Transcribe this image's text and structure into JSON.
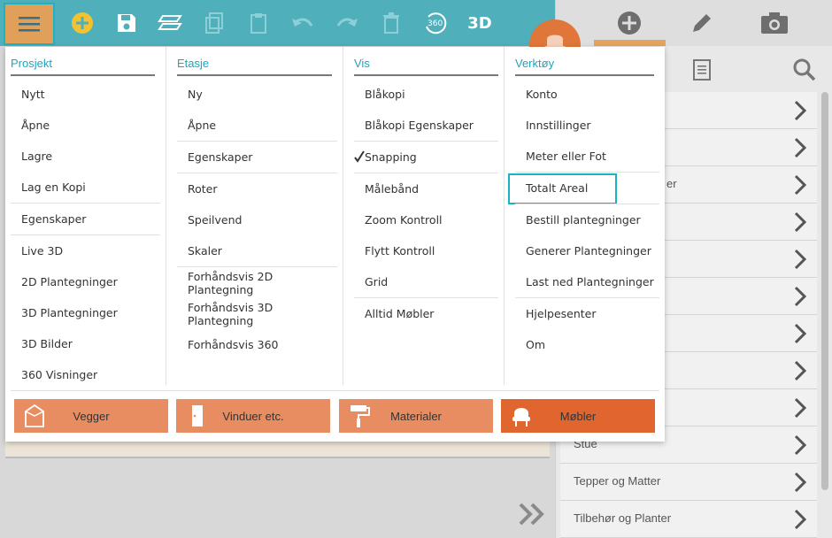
{
  "toolbar": {
    "buttons": [
      "menu-icon",
      "add-circle-icon",
      "save-icon",
      "layers-icon",
      "copy-icon",
      "clipboard-icon",
      "undo-icon",
      "redo-icon",
      "trash-icon",
      "view-360-icon",
      "view-3d-icon"
    ],
    "view_360_label": "360",
    "view_3d_label": "3D"
  },
  "colors": {
    "toolbar_bg": "#4fb0bb",
    "menu_button_bg": "#e0a05a",
    "highlight": "#1cb2c6",
    "column_header": "#1aa7bd",
    "category_button": "#e88d62",
    "category_button_active": "#e0652f"
  },
  "right_panel": {
    "tabs": [
      "add-circle-icon",
      "pencil-icon",
      "camera-icon"
    ],
    "sub_icons": [
      "document-icon",
      "search-icon"
    ],
    "partial_text": "er",
    "items": [
      "",
      "",
      "",
      "",
      "",
      "",
      "",
      "",
      "",
      "Stue",
      "Tepper og Matter",
      "Tilbehør og Planter"
    ]
  },
  "menu": {
    "columns": [
      {
        "header": "Prosjekt",
        "items": [
          "Nytt",
          "Åpne",
          "Lagre",
          "Lag en Kopi",
          "Egenskaper",
          "Live 3D",
          "2D Plantegninger",
          "3D Plantegninger",
          "3D Bilder",
          "360 Visninger"
        ]
      },
      {
        "header": "Etasje",
        "items": [
          "Ny",
          "Åpne",
          "Egenskaper",
          "Roter",
          "Speilvend",
          "Skaler",
          "Forhåndsvis 2D Plantegning",
          "Forhåndsvis 3D Plantegning",
          "Forhåndsvis 360"
        ]
      },
      {
        "header": "Vis",
        "items": [
          "Blåkopi",
          "Blåkopi Egenskaper",
          "Snapping",
          "Målebånd",
          "Zoom Kontroll",
          "Flytt Kontroll",
          "Grid",
          "Alltid Møbler"
        ]
      },
      {
        "header": "Verktøy",
        "items": [
          "Konto",
          "Innstillinger",
          "Meter eller Fot",
          "Totalt Areal",
          "Bestill plantegninger",
          "Generer Plantegninger",
          "Last ned Plantegninger",
          "Hjelpesenter",
          "Om"
        ]
      }
    ],
    "checked_item": "Snapping",
    "highlighted_item": "Totalt Areal",
    "categories": [
      "Vegger",
      "Vinduer etc.",
      "Materialer",
      "Møbler"
    ]
  }
}
